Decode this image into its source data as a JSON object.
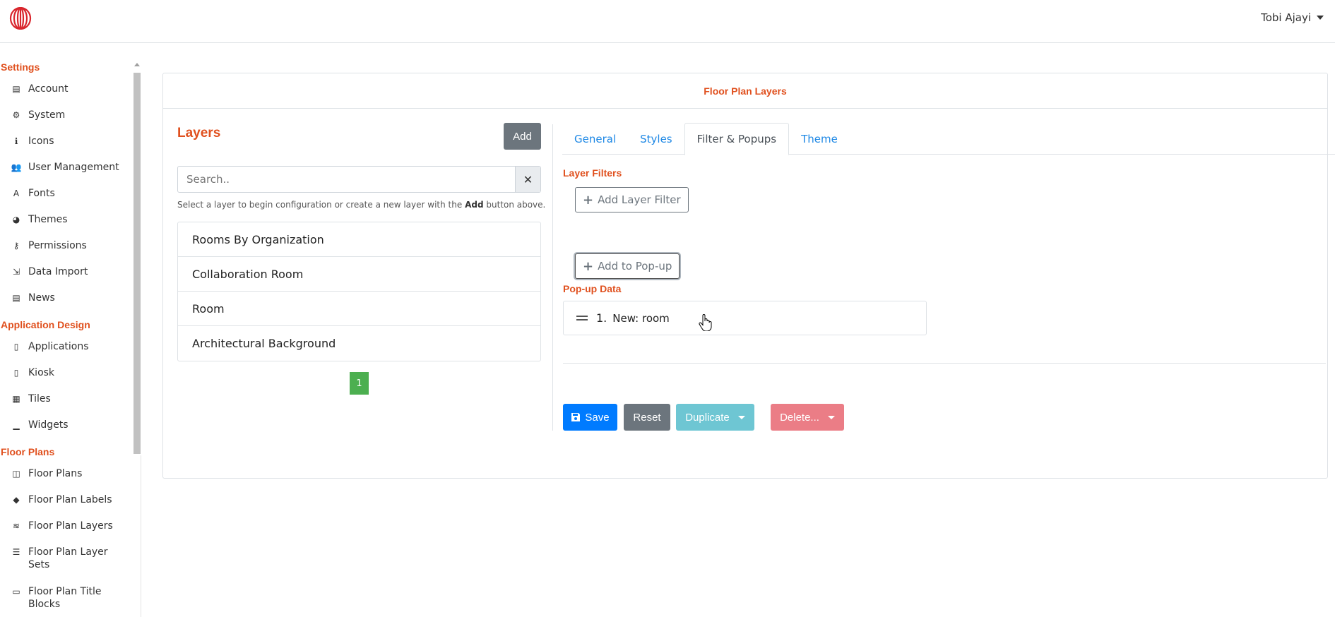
{
  "user": {
    "name": "Tobi Ajayi"
  },
  "sidebar": {
    "sections": [
      {
        "title": "Settings",
        "items": [
          {
            "label": "Account",
            "icon": "table-icon"
          },
          {
            "label": "System",
            "icon": "gear-icon"
          },
          {
            "label": "Icons",
            "icon": "info-icon"
          },
          {
            "label": "User Management",
            "icon": "users-icon"
          },
          {
            "label": "Fonts",
            "icon": "font-icon"
          },
          {
            "label": "Themes",
            "icon": "palette-icon"
          },
          {
            "label": "Permissions",
            "icon": "key-icon"
          },
          {
            "label": "Data Import",
            "icon": "import-icon"
          },
          {
            "label": "News",
            "icon": "newspaper-icon"
          }
        ]
      },
      {
        "title": "Application Design",
        "items": [
          {
            "label": "Applications",
            "icon": "tablet-icon"
          },
          {
            "label": "Kiosk",
            "icon": "tablet-icon"
          },
          {
            "label": "Tiles",
            "icon": "grid-icon"
          },
          {
            "label": "Widgets",
            "icon": "chart-icon"
          }
        ]
      },
      {
        "title": "Floor Plans",
        "items": [
          {
            "label": "Floor Plans",
            "icon": "map-icon"
          },
          {
            "label": "Floor Plan Labels",
            "icon": "tags-icon"
          },
          {
            "label": "Floor Plan Layers",
            "icon": "layers-icon"
          },
          {
            "label": "Floor Plan Layer Sets",
            "icon": "list-check-icon"
          },
          {
            "label": "Floor Plan Title Blocks",
            "icon": "print-icon"
          }
        ]
      }
    ]
  },
  "card": {
    "title": "Floor Plan Layers"
  },
  "layers": {
    "title": "Layers",
    "add_label": "Add",
    "search_placeholder": "Search..",
    "help_prefix": "Select a layer to begin configuration or create a new layer with the ",
    "help_bold": "Add",
    "help_suffix": " button above.",
    "items": [
      "Rooms By Organization",
      "Collaboration Room",
      "Room",
      "Architectural Background"
    ],
    "page": "1"
  },
  "tabs": [
    "General",
    "Styles",
    "Filter & Popups",
    "Theme"
  ],
  "active_tab": "Filter & Popups",
  "filter": {
    "add_filter_label": "Add Layer Filter",
    "filters_title": "Layer Filters",
    "add_popup_label": "Add to Pop-up",
    "popup_title": "Pop-up Data",
    "popup_items": [
      {
        "num": "1.",
        "text": "New: room"
      }
    ]
  },
  "actions": {
    "save": "Save",
    "reset": "Reset",
    "duplicate": "Duplicate",
    "delete": "Delete..."
  },
  "colors": {
    "accent": "#e0501e",
    "link": "#1e88e5",
    "primary": "#007bff",
    "secondary": "#6c757d",
    "info": "#6ec6d3",
    "danger": "#eb7d86",
    "success": "#4caf50"
  }
}
